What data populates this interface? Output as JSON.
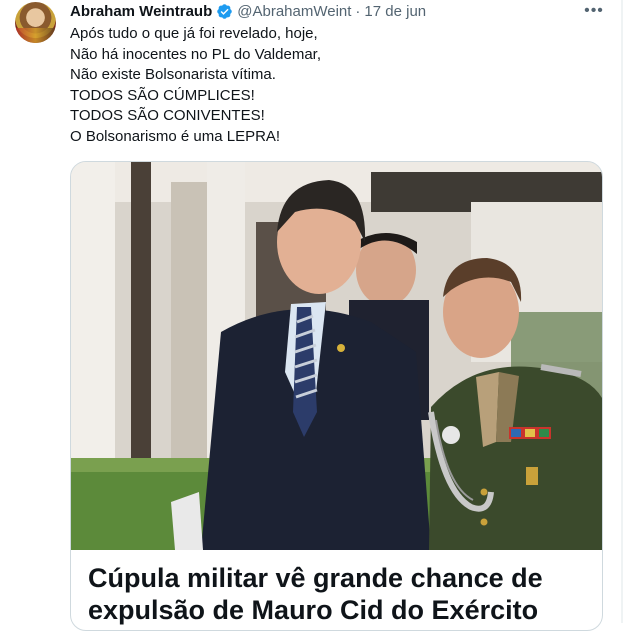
{
  "tweet": {
    "author": {
      "display_name": "Abraham Weintraub",
      "handle": "@AbrahamWeint",
      "verified_icon": "verified-badge-icon"
    },
    "separator": "·",
    "time": "17 de jun",
    "more_icon": "more-options-icon",
    "more_label": "•••",
    "text_lines": [
      "Após tudo o que já foi revelado, hoje,",
      "Não há inocentes no PL do Valdemar,",
      "Não existe Bolsonarista vítima.",
      "TODOS SÃO CÚMPLICES!",
      "TODOS SÃO CONIVENTES!",
      "O Bolsonarismo é uma LEPRA!"
    ],
    "card": {
      "title": "Cúpula militar vê grande chance de expulsão de Mauro Cid do Exército"
    }
  },
  "colors": {
    "text_primary": "#0f1419",
    "text_secondary": "#536471",
    "verified_blue": "#1d9bf0",
    "border": "#cfd9de",
    "suit": "#1c2233",
    "army_green": "#3b4a2c"
  }
}
